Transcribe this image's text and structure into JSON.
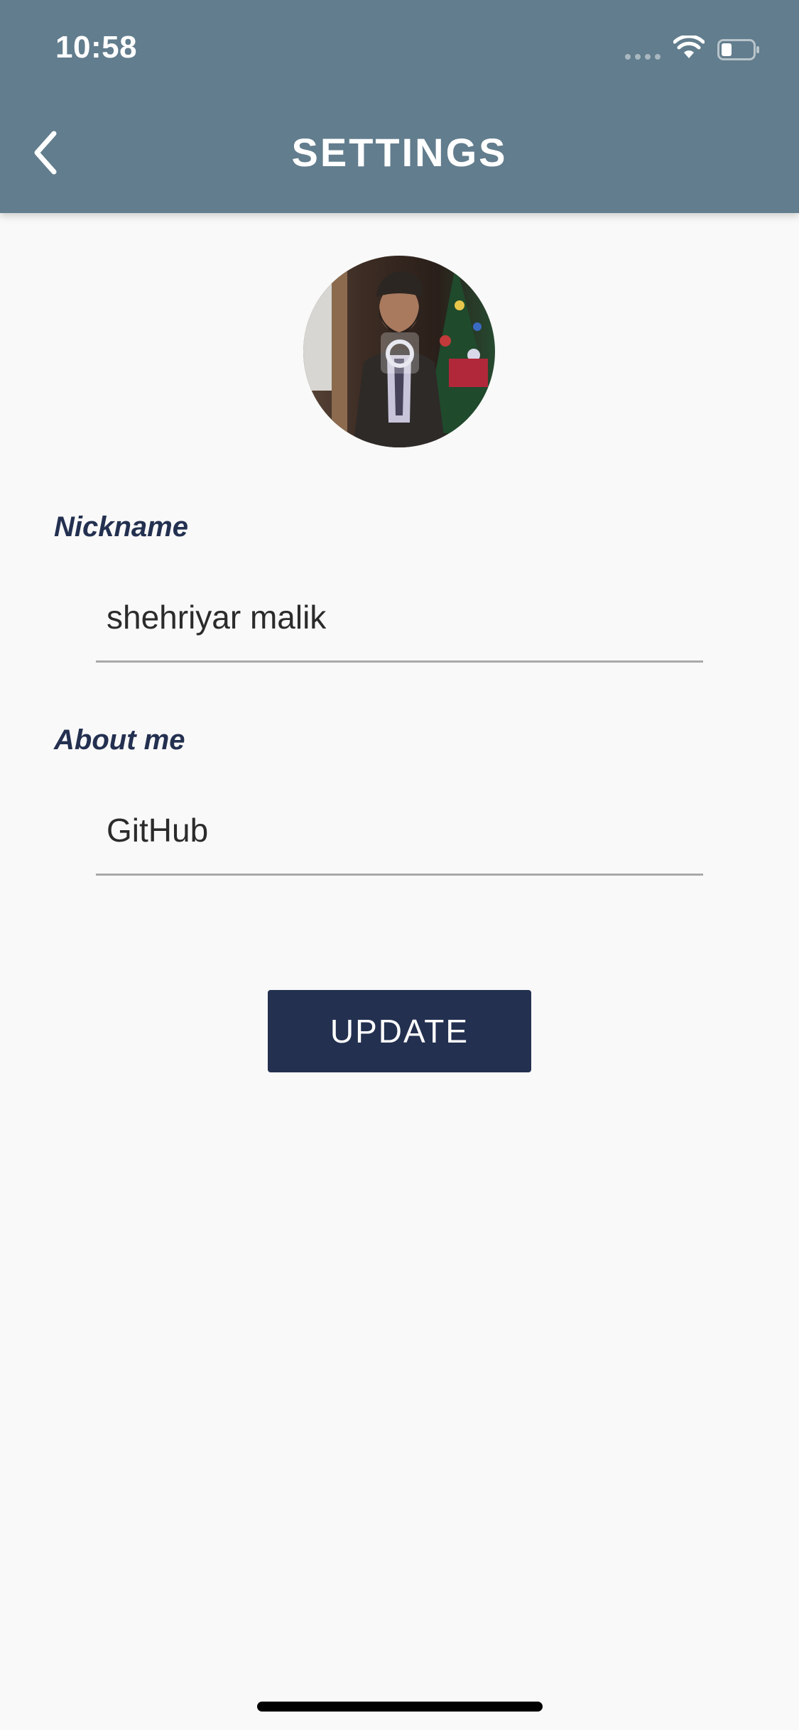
{
  "status_bar": {
    "time": "10:58",
    "icons": [
      "signal-dots-icon",
      "wifi-icon",
      "battery-icon"
    ]
  },
  "app_bar": {
    "title": "SETTINGS",
    "back_icon": "chevron-left-icon",
    "background_color": "#627d8d"
  },
  "profile": {
    "avatar_icon": "user-photo-avatar",
    "overlay_icon": "camera-icon"
  },
  "form": {
    "nickname": {
      "label": "Nickname",
      "value": "shehriyar malik"
    },
    "about": {
      "label": "About me",
      "value": "GitHub"
    },
    "update_label": "UPDATE"
  },
  "colors": {
    "accent": "#233050",
    "background": "#f9f9f9",
    "app_bar": "#627d8d"
  }
}
